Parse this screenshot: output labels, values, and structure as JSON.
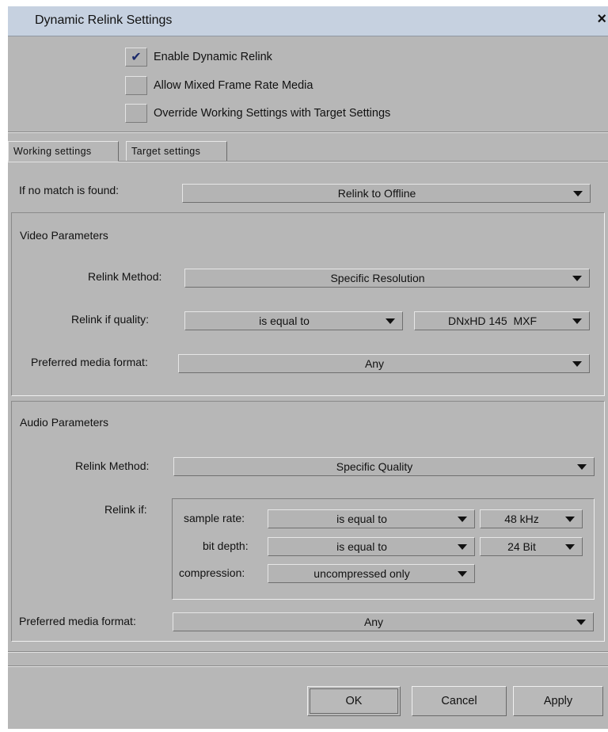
{
  "window": {
    "title": "Dynamic Relink Settings",
    "close_glyph": "×"
  },
  "options": {
    "enable_dynamic_relink": {
      "label": "Enable Dynamic Relink",
      "checked": true
    },
    "allow_mixed_frame_rate": {
      "label": "Allow Mixed Frame Rate Media",
      "checked": false
    },
    "override_working_settings": {
      "label": "Override Working Settings with Target Settings",
      "checked": false
    }
  },
  "tabs": [
    {
      "label": "Working settings",
      "active": true
    },
    {
      "label": "Target settings",
      "active": false
    }
  ],
  "no_match": {
    "label": "If no match is found:",
    "value": "Relink to Offline"
  },
  "video": {
    "heading": "Video Parameters",
    "relink_method": {
      "label": "Relink Method:",
      "value": "Specific Resolution"
    },
    "relink_if_quality": {
      "label": "Relink if quality:",
      "operator": "is equal to",
      "value": "DNxHD 145  MXF"
    },
    "preferred_format": {
      "label": "Preferred media format:",
      "value": "Any"
    }
  },
  "audio": {
    "heading": "Audio Parameters",
    "relink_method": {
      "label": "Relink Method:",
      "value": "Specific Quality"
    },
    "relink_if_label": "Relink if:",
    "sample_rate": {
      "label": "sample rate:",
      "operator": "is equal to",
      "value": "48 kHz"
    },
    "bit_depth": {
      "label": "bit depth:",
      "operator": "is equal to",
      "value": "24 Bit"
    },
    "compression": {
      "label": "compression:",
      "value": "uncompressed only"
    },
    "preferred_format": {
      "label": "Preferred media format:",
      "value": "Any"
    }
  },
  "buttons": {
    "ok": "OK",
    "cancel": "Cancel",
    "apply": "Apply"
  },
  "colors": {
    "dialog_bg": "#b7b7b7",
    "titlebar_bg": "#c6d1e0",
    "checkmark": "#1b2a6b"
  }
}
